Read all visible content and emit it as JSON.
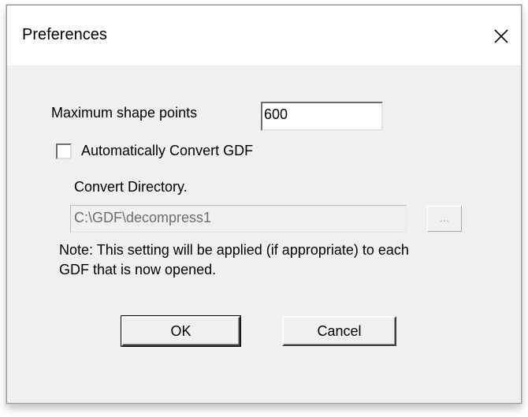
{
  "window": {
    "title": "Preferences",
    "close_icon": "close-icon"
  },
  "form": {
    "max_points_label": "Maximum shape points",
    "max_points_value": "600",
    "auto_convert_label": "Automatically Convert GDF",
    "auto_convert_checked": false,
    "convert_dir_label": "Convert Directory.",
    "convert_dir_value": "C:\\GDF\\decompress1",
    "browse_label": "...",
    "note_line1": "Note: This setting will be applied (if appropriate) to each",
    "note_line2": "GDF that is now opened."
  },
  "buttons": {
    "ok_label": "OK",
    "cancel_label": "Cancel"
  },
  "colors": {
    "client_bg": "#f0f0f0",
    "titlebar_bg": "#ffffff",
    "disabled_text": "#6d6d6d"
  }
}
